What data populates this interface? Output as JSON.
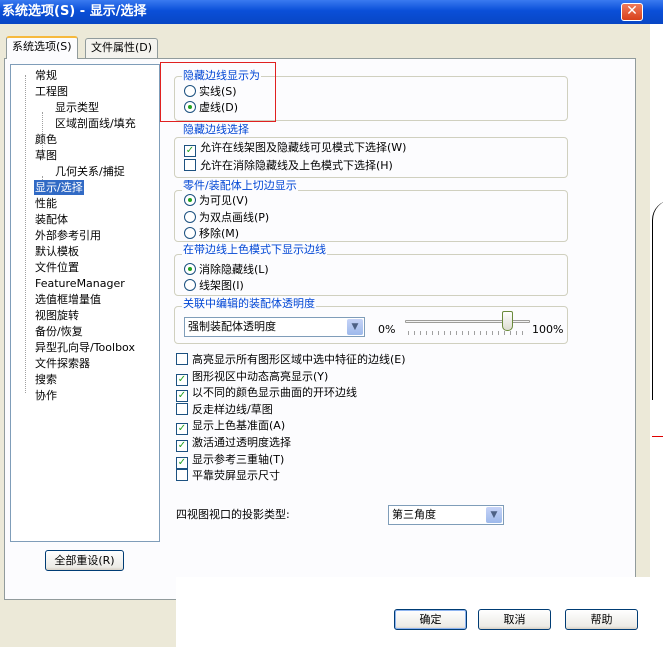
{
  "window": {
    "title": "系统选项(S) - 显示/选择",
    "close_symbol": "✕"
  },
  "tabs": [
    {
      "label": "系统选项(S)"
    },
    {
      "label": "文件属性(D)"
    }
  ],
  "tree": {
    "items": [
      {
        "label": "常规"
      },
      {
        "label": "工程图"
      },
      {
        "label": "显示类型"
      },
      {
        "label": "区域剖面线/填充"
      },
      {
        "label": "颜色"
      },
      {
        "label": "草图"
      },
      {
        "label": "几何关系/捕捉"
      },
      {
        "label": "显示/选择"
      },
      {
        "label": "性能"
      },
      {
        "label": "装配体"
      },
      {
        "label": "外部参考引用"
      },
      {
        "label": "默认模板"
      },
      {
        "label": "文件位置"
      },
      {
        "label": "FeatureManager"
      },
      {
        "label": "选值框增量值"
      },
      {
        "label": "视图旋转"
      },
      {
        "label": "备份/恢复"
      },
      {
        "label": "异型孔向导/Toolbox"
      },
      {
        "label": "文件探索器"
      },
      {
        "label": "搜索"
      },
      {
        "label": "协作"
      }
    ],
    "reset_button": "全部重设(R)"
  },
  "hidden_edges_display": {
    "title": "隐藏边线显示为",
    "options": [
      {
        "label": "实线(S)",
        "selected": false
      },
      {
        "label": "虚线(D)",
        "selected": true
      }
    ]
  },
  "hidden_edges_select": {
    "title": "隐藏边线选择",
    "options": [
      {
        "label": "允许在线架图及隐藏线可见模式下选择(W)",
        "checked": true
      },
      {
        "label": "允许在消除隐藏线及上色模式下选择(H)",
        "checked": false
      }
    ]
  },
  "tangent_edges": {
    "title": "零件/装配体上切边显示",
    "options": [
      {
        "label": "为可见(V)",
        "selected": true
      },
      {
        "label": "为双点画线(P)",
        "selected": false
      },
      {
        "label": "移除(M)",
        "selected": false
      }
    ]
  },
  "shaded_edges": {
    "title": "在带边线上色模式下显示边线",
    "options": [
      {
        "label": "消除隐藏线(L)",
        "selected": true
      },
      {
        "label": "线架图(I)",
        "selected": false
      }
    ]
  },
  "assembly_transparency": {
    "title": "关联中编辑的装配体透明度",
    "select_value": "强制装配体透明度",
    "min_label": "0%",
    "max_label": "100%",
    "level": 0.82
  },
  "checkboxes": [
    {
      "label": "高亮显示所有图形区域中选中特征的边线(E)",
      "checked": false
    },
    {
      "label": "图形视区中动态高亮显示(Y)",
      "checked": true
    },
    {
      "label": "以不同的颜色显示曲面的开环边线",
      "checked": true
    },
    {
      "label": "反走样边线/草图",
      "checked": false
    },
    {
      "label": "显示上色基准面(A)",
      "checked": true
    },
    {
      "label": "激活通过透明度选择",
      "checked": true
    },
    {
      "label": "显示参考三重轴(T)",
      "checked": true
    },
    {
      "label": "平靠荧屏显示尺寸",
      "checked": false
    }
  ],
  "projection": {
    "label": "四视图视口的投影类型:",
    "value": "第三角度"
  },
  "footer": {
    "ok": "确定",
    "cancel": "取消",
    "help": "帮助"
  },
  "colors": {
    "group_title": "#0046d5",
    "title_bar": "#0a4fd8",
    "selection": "#316ac5",
    "highlight_box": "#e02020"
  }
}
